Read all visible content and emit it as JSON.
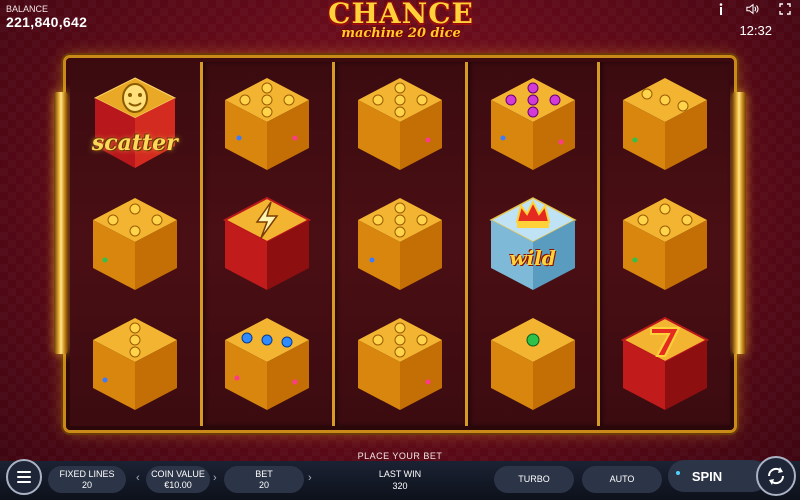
{
  "header": {
    "balance_label": "BALANCE",
    "balance_value": "221,840,642",
    "logo_main": "CHANCE",
    "logo_sub": "machine 20 dice",
    "clock": "12:32",
    "icons": [
      "info-icon",
      "sound-icon",
      "fullscreen-icon"
    ]
  },
  "reels": [
    [
      {
        "symbol": "scatter",
        "label": "scatter"
      },
      {
        "symbol": "dice-4",
        "pips": 4,
        "gem": "green"
      },
      {
        "symbol": "dice-3",
        "pips": 3,
        "gem": "blue"
      }
    ],
    [
      {
        "symbol": "dice-5",
        "pips": 5,
        "gem": "blue"
      },
      {
        "symbol": "lightning"
      },
      {
        "symbol": "dice-3-gems",
        "pips": 3,
        "pip_color": "blue"
      }
    ],
    [
      {
        "symbol": "dice-5",
        "pips": 5,
        "gem": "pink"
      },
      {
        "symbol": "dice-5",
        "pips": 5,
        "gem": "blue"
      },
      {
        "symbol": "dice-5",
        "pips": 5,
        "gem": "pink"
      }
    ],
    [
      {
        "symbol": "dice-5-purple",
        "pips": 5,
        "pip_color": "purple"
      },
      {
        "symbol": "wild",
        "label": "wild"
      },
      {
        "symbol": "dice-1-green",
        "pips": 1,
        "pip_color": "green"
      }
    ],
    [
      {
        "symbol": "dice-3",
        "pips": 3,
        "gem": "green"
      },
      {
        "symbol": "dice-4",
        "pips": 4,
        "gem": "green"
      },
      {
        "symbol": "seven"
      }
    ]
  ],
  "footer": {
    "place_bet": "PLACE YOUR BET",
    "fixed_lines_label": "FIXED LINES",
    "fixed_lines_value": "20",
    "coin_value_label": "COIN VALUE",
    "coin_value_value": "€10.00",
    "bet_label": "BET",
    "bet_value": "20",
    "last_win_label": "LAST WIN",
    "last_win_value": "320",
    "turbo_label": "TURBO",
    "auto_label": "AUTO",
    "spin_label": "SPIN"
  },
  "colors": {
    "background": "#6e0d1e",
    "gold": "#d79b24",
    "bar": "#1b2233",
    "button": "#2c3447"
  }
}
